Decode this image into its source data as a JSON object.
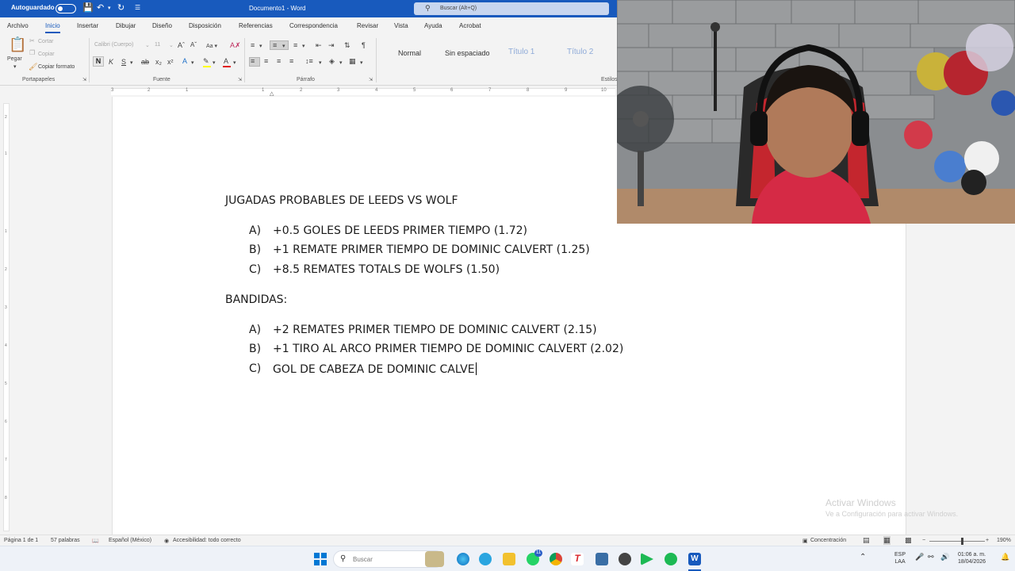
{
  "titlebar": {
    "autosave_label": "Autoguardado",
    "document_title": "Documento1  -  Word",
    "search_placeholder": "Buscar (Alt+Q)"
  },
  "tabs": [
    "Archivo",
    "Inicio",
    "Insertar",
    "Dibujar",
    "Diseño",
    "Disposición",
    "Referencias",
    "Correspondencia",
    "Revisar",
    "Vista",
    "Ayuda",
    "Acrobat"
  ],
  "ribbon": {
    "clipboard": {
      "paste": "Pegar",
      "cut": "Cortar",
      "copy": "Copiar",
      "format_painter": "Copiar formato",
      "label": "Portapapeles"
    },
    "font": {
      "family": "Calibri (Cuerpo)",
      "size": "11",
      "case": "Aa",
      "label": "Fuente"
    },
    "paragraph": {
      "label": "Párrafo"
    },
    "styles": {
      "items": [
        "Normal",
        "Sin espaciado",
        "Título 1",
        "Título 2"
      ],
      "label": "Estilos"
    }
  },
  "ruler_numbers": [
    "3",
    "2",
    "1",
    "1",
    "2",
    "3",
    "4",
    "5",
    "6",
    "7",
    "8",
    "9",
    "10"
  ],
  "vruler_numbers": [
    "2",
    "1",
    "1",
    "2",
    "3",
    "4",
    "5",
    "6",
    "7",
    "8"
  ],
  "document": {
    "heading1": "JUGADAS PROBABLES DE LEEDS VS WOLF",
    "list1": [
      {
        "letter": "A)",
        "text": "+0.5 GOLES DE LEEDS PRIMER TIEMPO (1.72)"
      },
      {
        "letter": "B)",
        "text": "+1 REMATE PRIMER TIEMPO DE DOMINIC CALVERT (1.25)"
      },
      {
        "letter": "C)",
        "text": "+8.5 REMATES TOTALS DE WOLFS (1.50)"
      }
    ],
    "heading2": "BANDIDAS:",
    "list2": [
      {
        "letter": "A)",
        "text": "+2 REMATES PRIMER TIEMPO DE DOMINIC CALVERT (2.15)"
      },
      {
        "letter": "B)",
        "text": "+1 TIRO AL ARCO PRIMER TIEMPO DE DOMINIC CALVERT (2.02)"
      },
      {
        "letter": "C)",
        "text": "GOL DE CABEZA DE DOMINIC CALVE"
      }
    ]
  },
  "watermark": {
    "title": "Activar Windows",
    "subtitle": "Ve a Configuración para activar Windows."
  },
  "statusbar": {
    "page": "Página 1 de 1",
    "words": "57 palabras",
    "language": "Español (México)",
    "accessibility": "Accesibilidad: todo correcto",
    "focus": "Concentración",
    "zoom": "190%"
  },
  "taskbar": {
    "search": "Buscar",
    "lang_top": "ESP",
    "lang_bottom": "LAA",
    "time": "01:06 a. m.",
    "date": "18/04/2026",
    "whatsapp_badge": "11"
  },
  "colors": {
    "word_blue": "#185abd",
    "highlight_yellow": "#ffff00",
    "font_red": "#e02020"
  }
}
